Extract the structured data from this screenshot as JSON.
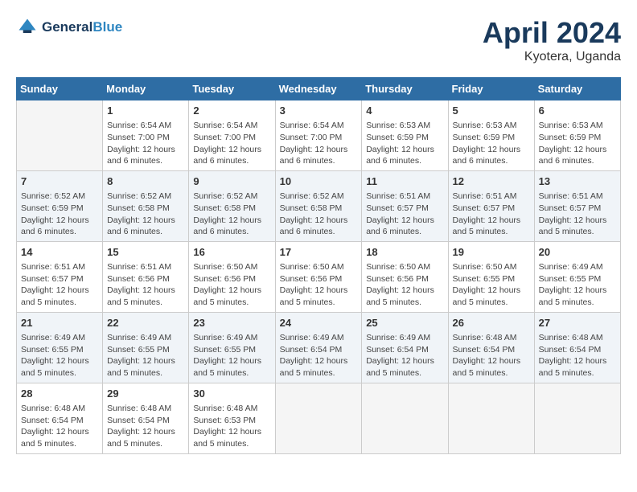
{
  "header": {
    "logo_line1": "General",
    "logo_line2": "Blue",
    "month_title": "April 2024",
    "location": "Kyotera, Uganda"
  },
  "calendar": {
    "days_of_week": [
      "Sunday",
      "Monday",
      "Tuesday",
      "Wednesday",
      "Thursday",
      "Friday",
      "Saturday"
    ],
    "weeks": [
      [
        {
          "num": "",
          "info": ""
        },
        {
          "num": "1",
          "info": "Sunrise: 6:54 AM\nSunset: 7:00 PM\nDaylight: 12 hours\nand 6 minutes."
        },
        {
          "num": "2",
          "info": "Sunrise: 6:54 AM\nSunset: 7:00 PM\nDaylight: 12 hours\nand 6 minutes."
        },
        {
          "num": "3",
          "info": "Sunrise: 6:54 AM\nSunset: 7:00 PM\nDaylight: 12 hours\nand 6 minutes."
        },
        {
          "num": "4",
          "info": "Sunrise: 6:53 AM\nSunset: 6:59 PM\nDaylight: 12 hours\nand 6 minutes."
        },
        {
          "num": "5",
          "info": "Sunrise: 6:53 AM\nSunset: 6:59 PM\nDaylight: 12 hours\nand 6 minutes."
        },
        {
          "num": "6",
          "info": "Sunrise: 6:53 AM\nSunset: 6:59 PM\nDaylight: 12 hours\nand 6 minutes."
        }
      ],
      [
        {
          "num": "7",
          "info": "Sunrise: 6:52 AM\nSunset: 6:59 PM\nDaylight: 12 hours\nand 6 minutes."
        },
        {
          "num": "8",
          "info": "Sunrise: 6:52 AM\nSunset: 6:58 PM\nDaylight: 12 hours\nand 6 minutes."
        },
        {
          "num": "9",
          "info": "Sunrise: 6:52 AM\nSunset: 6:58 PM\nDaylight: 12 hours\nand 6 minutes."
        },
        {
          "num": "10",
          "info": "Sunrise: 6:52 AM\nSunset: 6:58 PM\nDaylight: 12 hours\nand 6 minutes."
        },
        {
          "num": "11",
          "info": "Sunrise: 6:51 AM\nSunset: 6:57 PM\nDaylight: 12 hours\nand 6 minutes."
        },
        {
          "num": "12",
          "info": "Sunrise: 6:51 AM\nSunset: 6:57 PM\nDaylight: 12 hours\nand 5 minutes."
        },
        {
          "num": "13",
          "info": "Sunrise: 6:51 AM\nSunset: 6:57 PM\nDaylight: 12 hours\nand 5 minutes."
        }
      ],
      [
        {
          "num": "14",
          "info": "Sunrise: 6:51 AM\nSunset: 6:57 PM\nDaylight: 12 hours\nand 5 minutes."
        },
        {
          "num": "15",
          "info": "Sunrise: 6:51 AM\nSunset: 6:56 PM\nDaylight: 12 hours\nand 5 minutes."
        },
        {
          "num": "16",
          "info": "Sunrise: 6:50 AM\nSunset: 6:56 PM\nDaylight: 12 hours\nand 5 minutes."
        },
        {
          "num": "17",
          "info": "Sunrise: 6:50 AM\nSunset: 6:56 PM\nDaylight: 12 hours\nand 5 minutes."
        },
        {
          "num": "18",
          "info": "Sunrise: 6:50 AM\nSunset: 6:56 PM\nDaylight: 12 hours\nand 5 minutes."
        },
        {
          "num": "19",
          "info": "Sunrise: 6:50 AM\nSunset: 6:55 PM\nDaylight: 12 hours\nand 5 minutes."
        },
        {
          "num": "20",
          "info": "Sunrise: 6:49 AM\nSunset: 6:55 PM\nDaylight: 12 hours\nand 5 minutes."
        }
      ],
      [
        {
          "num": "21",
          "info": "Sunrise: 6:49 AM\nSunset: 6:55 PM\nDaylight: 12 hours\nand 5 minutes."
        },
        {
          "num": "22",
          "info": "Sunrise: 6:49 AM\nSunset: 6:55 PM\nDaylight: 12 hours\nand 5 minutes."
        },
        {
          "num": "23",
          "info": "Sunrise: 6:49 AM\nSunset: 6:55 PM\nDaylight: 12 hours\nand 5 minutes."
        },
        {
          "num": "24",
          "info": "Sunrise: 6:49 AM\nSunset: 6:54 PM\nDaylight: 12 hours\nand 5 minutes."
        },
        {
          "num": "25",
          "info": "Sunrise: 6:49 AM\nSunset: 6:54 PM\nDaylight: 12 hours\nand 5 minutes."
        },
        {
          "num": "26",
          "info": "Sunrise: 6:48 AM\nSunset: 6:54 PM\nDaylight: 12 hours\nand 5 minutes."
        },
        {
          "num": "27",
          "info": "Sunrise: 6:48 AM\nSunset: 6:54 PM\nDaylight: 12 hours\nand 5 minutes."
        }
      ],
      [
        {
          "num": "28",
          "info": "Sunrise: 6:48 AM\nSunset: 6:54 PM\nDaylight: 12 hours\nand 5 minutes."
        },
        {
          "num": "29",
          "info": "Sunrise: 6:48 AM\nSunset: 6:54 PM\nDaylight: 12 hours\nand 5 minutes."
        },
        {
          "num": "30",
          "info": "Sunrise: 6:48 AM\nSunset: 6:53 PM\nDaylight: 12 hours\nand 5 minutes."
        },
        {
          "num": "",
          "info": ""
        },
        {
          "num": "",
          "info": ""
        },
        {
          "num": "",
          "info": ""
        },
        {
          "num": "",
          "info": ""
        }
      ]
    ]
  }
}
